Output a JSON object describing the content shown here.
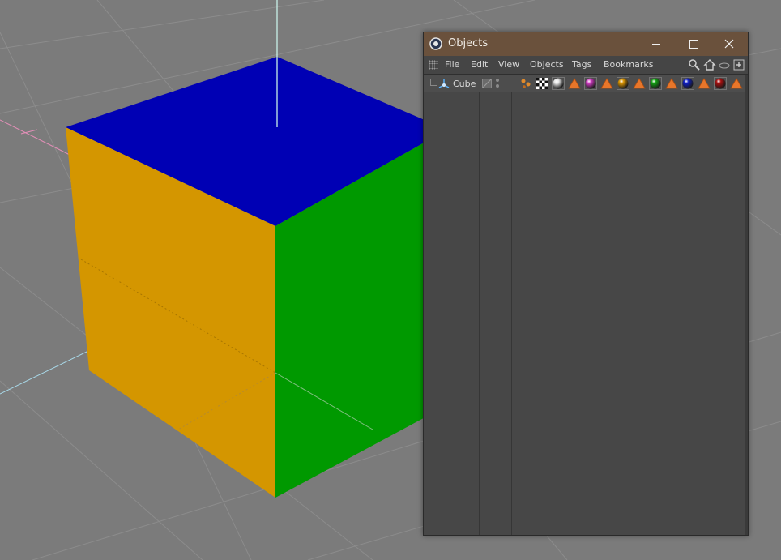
{
  "window": {
    "title": "Objects"
  },
  "menu": {
    "file": "File",
    "edit": "Edit",
    "view": "View",
    "objects": "Objects",
    "tags": "Tags",
    "bookmarks": "Bookmarks"
  },
  "objects": [
    {
      "name": "Cube",
      "icon": "cube-primitive-icon"
    }
  ],
  "tags": [
    {
      "type": "texture-tag-icon"
    },
    {
      "type": "checker-material-icon"
    },
    {
      "type": "material-ball-icon",
      "color": "#e6e6e6"
    },
    {
      "type": "polygon-selection-tag-icon"
    },
    {
      "type": "material-ball-icon",
      "color": "#d23bc4"
    },
    {
      "type": "polygon-selection-tag-icon"
    },
    {
      "type": "material-ball-icon",
      "color": "#d99300"
    },
    {
      "type": "polygon-selection-tag-icon"
    },
    {
      "type": "material-ball-icon",
      "color": "#11a111"
    },
    {
      "type": "polygon-selection-tag-icon"
    },
    {
      "type": "material-ball-icon",
      "color": "#0d1cc6"
    },
    {
      "type": "polygon-selection-tag-icon"
    },
    {
      "type": "material-ball-icon",
      "color": "#a80e0e"
    },
    {
      "type": "polygon-selection-tag-icon"
    }
  ],
  "colors": {
    "cube_top": "#0000b4",
    "cube_left": "#d49600",
    "cube_right": "#009900",
    "titlebar": "#6a513c",
    "panel_bg": "#474747"
  }
}
